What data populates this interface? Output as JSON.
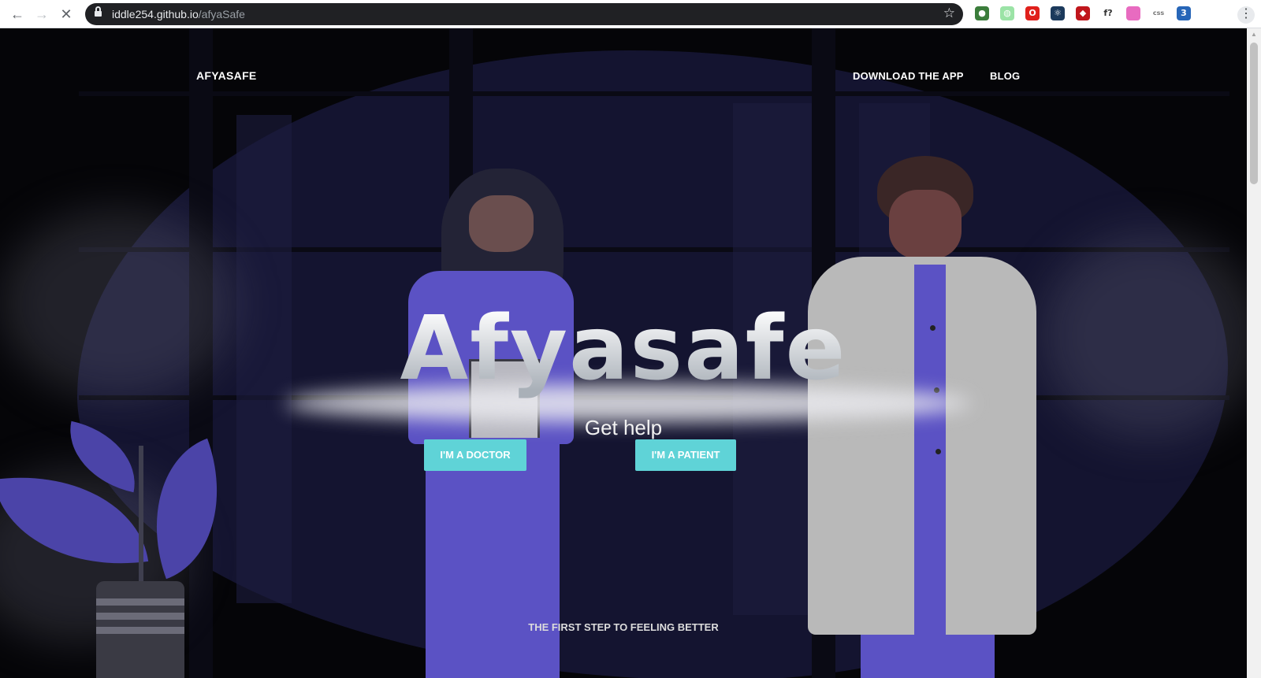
{
  "browser": {
    "url_host": "iddle254.github.io",
    "url_path": "/afyaSafe",
    "icons": [
      "back-arrow-icon",
      "forward-arrow-icon",
      "stop-loading-icon",
      "lock-icon",
      "bookmark-star-icon",
      "more-menu-icon"
    ],
    "extensions": [
      {
        "name": "extension-globe-icon",
        "color": "#3b7d3b",
        "glyph": "●"
      },
      {
        "name": "extension-spiral-icon",
        "color": "#9be3a6",
        "glyph": "◍"
      },
      {
        "name": "extension-opera-icon",
        "color": "#e0201b",
        "glyph": "O"
      },
      {
        "name": "extension-react-icon",
        "color": "#1c3a5c",
        "glyph": "⚛"
      },
      {
        "name": "extension-ruby-icon",
        "color": "#c0161c",
        "glyph": "◆"
      },
      {
        "name": "extension-font-icon",
        "color": "#ffffff",
        "glyph": "f?"
      },
      {
        "name": "extension-gradient-icon",
        "color": "#e86bc0",
        "glyph": " "
      },
      {
        "name": "extension-css-text-icon",
        "color": "#ffffff",
        "glyph": "css"
      },
      {
        "name": "extension-css3-icon",
        "color": "#2766b8",
        "glyph": "3"
      }
    ]
  },
  "nav": {
    "brand": "AFYASAFE",
    "links": [
      "DOWNLOAD THE APP",
      "BLOG"
    ]
  },
  "hero": {
    "title": "Afyasafe",
    "subtitle": "Get help",
    "buttons": [
      "I'M A DOCTOR",
      "I'M A PATIENT"
    ],
    "tagline": "THE FIRST STEP TO FEELING BETTER"
  },
  "colors": {
    "accent": "#5fd3d7",
    "scrubs": "#5b52c4",
    "background": "#050508"
  }
}
